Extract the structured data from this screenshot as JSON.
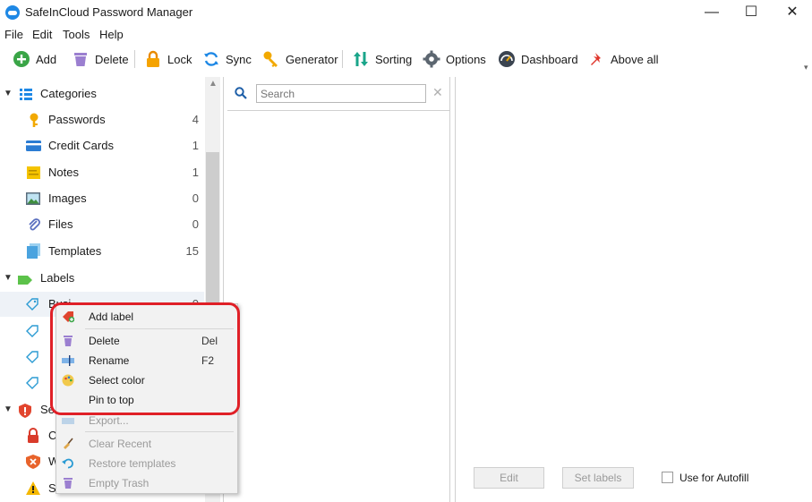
{
  "window": {
    "title": "SafeInCloud Password Manager",
    "minimize": "—",
    "maximize": "☐",
    "close": "✕"
  },
  "menu": [
    "File",
    "Edit",
    "Tools",
    "Help"
  ],
  "toolbar": [
    {
      "label": "Add"
    },
    {
      "label": "Delete"
    },
    {
      "label": "Lock"
    },
    {
      "label": "Sync"
    },
    {
      "label": "Generator"
    },
    {
      "label": "Sorting"
    },
    {
      "label": "Options"
    },
    {
      "label": "Dashboard"
    },
    {
      "label": "Above all"
    }
  ],
  "sidebar": {
    "categories_header": "Categories",
    "categories": [
      {
        "label": "Passwords",
        "count": "4",
        "color": "#f2a900"
      },
      {
        "label": "Credit Cards",
        "count": "1",
        "color": "#2b7cd3"
      },
      {
        "label": "Notes",
        "count": "1",
        "color": "#f5c400"
      },
      {
        "label": "Images",
        "count": "0",
        "color": "#3f8f3f"
      },
      {
        "label": "Files",
        "count": "0",
        "color": "#5a6fbf"
      },
      {
        "label": "Templates",
        "count": "15",
        "color": "#4aa3df"
      }
    ],
    "labels_header": "Labels",
    "label_partial": "Busi",
    "label_partial_count": "0",
    "security_partial": "Se",
    "security_items_partial": [
      "C",
      "W",
      "S"
    ]
  },
  "search": {
    "placeholder": "Search",
    "clear": "✕"
  },
  "details": {
    "edit": "Edit",
    "set_labels": "Set labels",
    "autofill": "Use for Autofill"
  },
  "context_menu": {
    "items": [
      {
        "label": "Add label",
        "shortcut": "",
        "enabled": true
      },
      {
        "label": "Delete",
        "shortcut": "Del",
        "enabled": true
      },
      {
        "label": "Rename",
        "shortcut": "F2",
        "enabled": true
      },
      {
        "label": "Select color",
        "shortcut": "",
        "enabled": true
      },
      {
        "label": "Pin to top",
        "shortcut": "",
        "enabled": true
      },
      {
        "label": "Export...",
        "shortcut": "",
        "enabled": false
      },
      {
        "label": "Clear Recent",
        "shortcut": "",
        "enabled": false
      },
      {
        "label": "Restore templates",
        "shortcut": "",
        "enabled": false
      },
      {
        "label": "Empty Trash",
        "shortcut": "",
        "enabled": false
      }
    ]
  },
  "colors": {
    "accent": "#1e88e5",
    "highlight": "#e02027"
  }
}
